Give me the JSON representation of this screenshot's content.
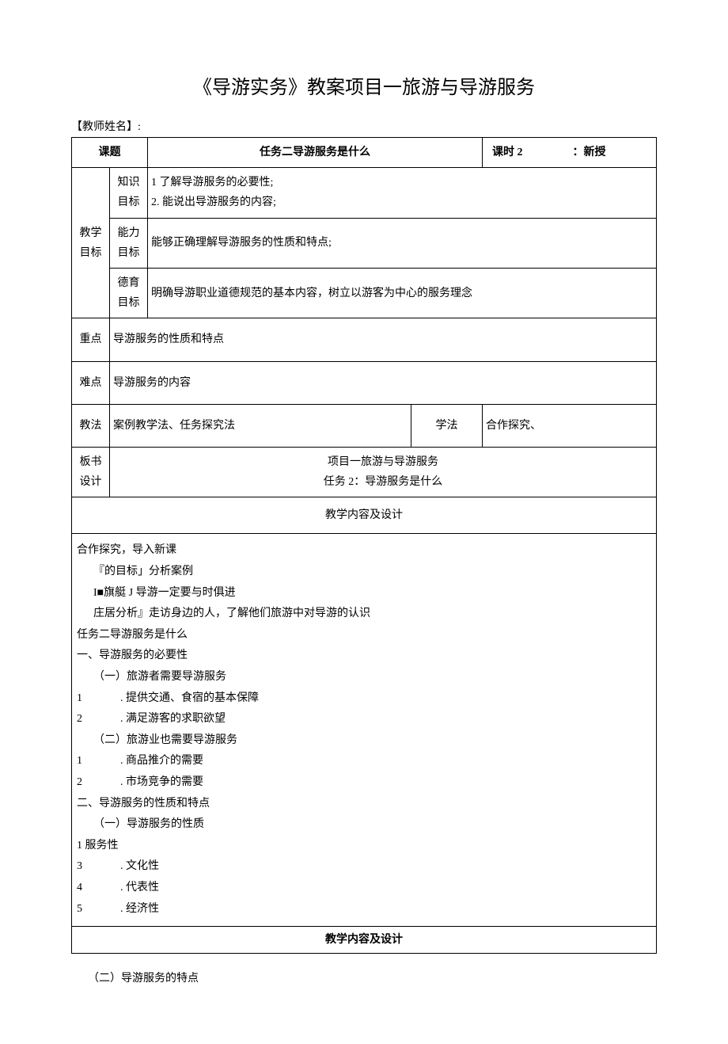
{
  "title": "《导游实务》教案项目一旅游与导游服务",
  "teacher_label": "【教师姓名】:",
  "row_topic": {
    "label": "课题",
    "value": "任务二导游服务是什么",
    "hours_label": "课时 2",
    "type_label": "：新授"
  },
  "goals": {
    "label": "教学\n目标",
    "knowledge": {
      "label": "知识\n目标",
      "line1": "1 了解导游服务的必要性;",
      "line2": "2. 能说出导游服务的内容;"
    },
    "ability": {
      "label": "能力\n目标",
      "text": "能够正确理解导游服务的性质和特点;"
    },
    "moral": {
      "label": "德育\n目标",
      "text": "明确导游职业道德规范的基本内容，树立以游客为中心的服务理念"
    }
  },
  "key": {
    "label": "重点",
    "text": "导游服务的性质和特点"
  },
  "difficulty": {
    "label": "难点",
    "text": "导游服务的内容"
  },
  "method": {
    "label": "教法",
    "teach": "案例教学法、任务探究法",
    "learn_label": "学法",
    "learn": "合作探究、"
  },
  "board": {
    "label": "板书\n设计",
    "line1": "项目一旅游与导游服务",
    "line2": "任务 2：导游服务是什么"
  },
  "content_header": "教学内容及设计",
  "content": {
    "l1": "合作探究，导入新课",
    "l2": "『的目标」分析案例",
    "l3": "I■旗艇 J 导游一定要与时俱进",
    "l4": "庄居分析』走访身边的人，了解他们旅游中对导游的认识",
    "blank": " ",
    "l5": "任务二导游服务是什么",
    "l6": "一、导游服务的必要性",
    "l7": "（一）旅游者需要导游服务",
    "l8a": "1",
    "l8b": ". 提供交通、食宿的基本保障",
    "l9a": "2",
    "l9b": ". 满足游客的求职欲望",
    "l10": "（二）旅游业也需要导游服务",
    "l11a": "1",
    "l11b": ". 商品推介的需要",
    "l12a": "2",
    "l12b": ". 市场竞争的需要",
    "l13": "二、导游服务的性质和特点",
    "l14": "（一）导游服务的性质",
    "l15": "1 服务性",
    "l16a": "3",
    "l16b": ". 文化性",
    "l17a": "4",
    "l17b": ". 代表性",
    "l18a": "5",
    "l18b": ". 经济性"
  },
  "content_header2": "教学内容及设计",
  "footer": "（二）导游服务的特点"
}
